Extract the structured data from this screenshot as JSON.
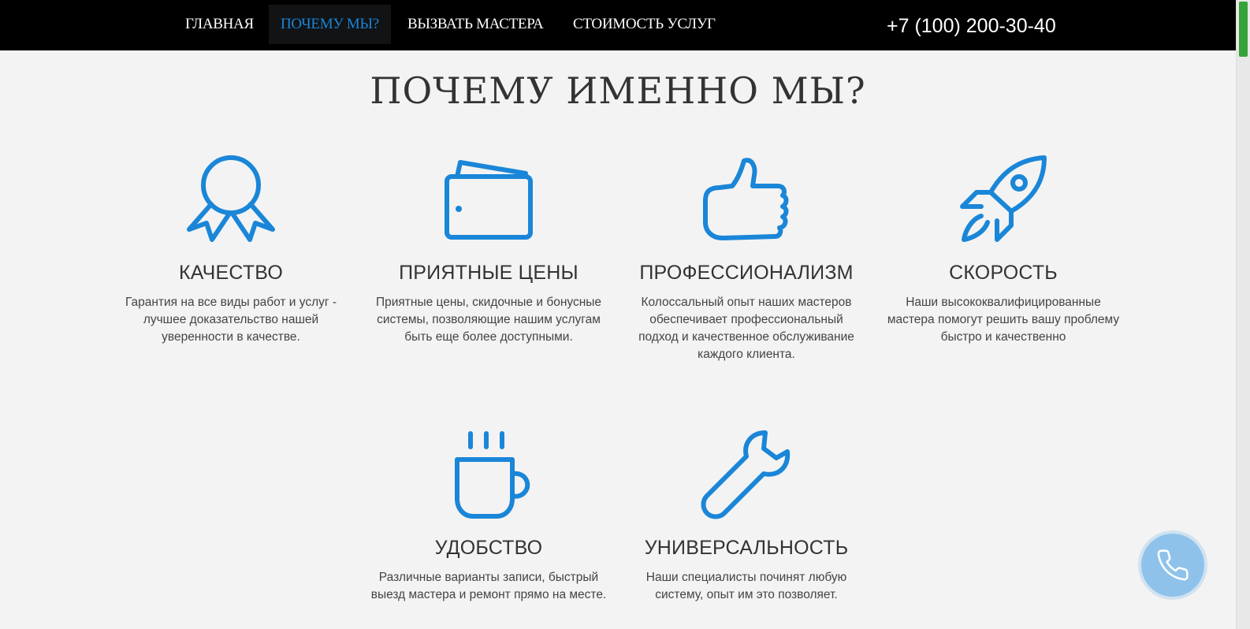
{
  "nav": {
    "items": [
      {
        "label": "Главная"
      },
      {
        "label": "Почему мы?"
      },
      {
        "label": "Вызвать мастера"
      },
      {
        "label": "Стоимость услуг"
      }
    ],
    "phone": "+7 (100) 200-30-40"
  },
  "main": {
    "title": "ПОЧЕМУ ИМЕННО МЫ?",
    "features": [
      {
        "title": "КАЧЕСТВО",
        "text": "Гарантия на все виды работ и услуг - лучшее доказательство нашей уверенности в качестве.",
        "icon": "award-ribbon-icon"
      },
      {
        "title": "ПРИЯТНЫЕ ЦЕНЫ",
        "text": "Приятные цены, скидочные и бонусные системы, позволяющие нашим услугам быть еще более доступными.",
        "icon": "wallet-icon"
      },
      {
        "title": "ПРОФЕССИОНАЛИЗМ",
        "text": "Колоссальный опыт наших мастеров обеспечивает профессиональный подход и качественное обслуживание каждого клиента.",
        "icon": "thumbs-up-icon"
      },
      {
        "title": "СКОРОСТЬ",
        "text": "Наши высококвалифицированные мастера помогут решить вашу проблему быстро и качественно",
        "icon": "rocket-icon"
      },
      {
        "title": "УДОБСТВО",
        "text": "Различные варианты записи, быстрый выезд мастера и ремонт прямо на месте.",
        "icon": "coffee-mug-icon"
      },
      {
        "title": "УНИВЕРСАЛЬНОСТЬ",
        "text": "Наши специалисты починят любую систему, опыт им это позволяет.",
        "icon": "wrench-icon"
      }
    ]
  },
  "call_button": {
    "icon": "phone-icon"
  },
  "colors": {
    "accent": "#1a86d8",
    "nav_bg": "#000000",
    "page_bg": "#f3f3f3",
    "call_button": "#8ec2ea"
  }
}
